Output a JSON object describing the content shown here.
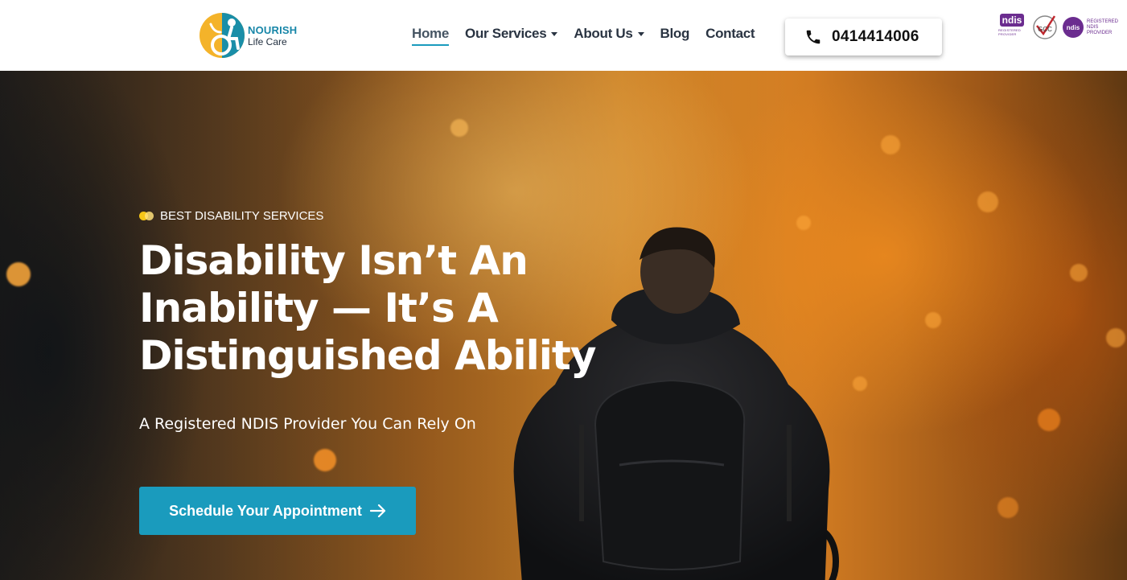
{
  "header": {
    "logo": {
      "brand": "NOURISH",
      "sub": "Life Care"
    },
    "nav": [
      {
        "label": "Home",
        "active": true,
        "dropdown": false
      },
      {
        "label": "Our Services",
        "active": false,
        "dropdown": true
      },
      {
        "label": "About Us",
        "active": false,
        "dropdown": true
      },
      {
        "label": "Blog",
        "active": false,
        "dropdown": false
      },
      {
        "label": "Contact",
        "active": false,
        "dropdown": false
      }
    ],
    "phone": {
      "number": "0414414006",
      "icon": "phone-icon"
    },
    "badges": {
      "ndis_word": "ndis",
      "ndis_sub": "REGISTERED PROVIDER",
      "gcc": "GCC",
      "reg_circle": "ndis",
      "reg_text": "REGISTERED NDIS PROVIDER"
    }
  },
  "hero": {
    "eyebrow": "BEST DISABILITY SERVICES",
    "title": "Disability Isn’t An Inability — It’s A Distinguished Ability",
    "subtitle": "A Registered NDIS Provider You Can Rely On",
    "cta": {
      "label": "Schedule Your Appointment",
      "icon": "arrow-right-icon"
    }
  },
  "colors": {
    "accent": "#1a9bbd",
    "brand_text": "#1786a8",
    "nav_text": "#2a3442",
    "ndis_purple": "#6b2c8f",
    "eyebrow_yellow": "#f5c518"
  }
}
